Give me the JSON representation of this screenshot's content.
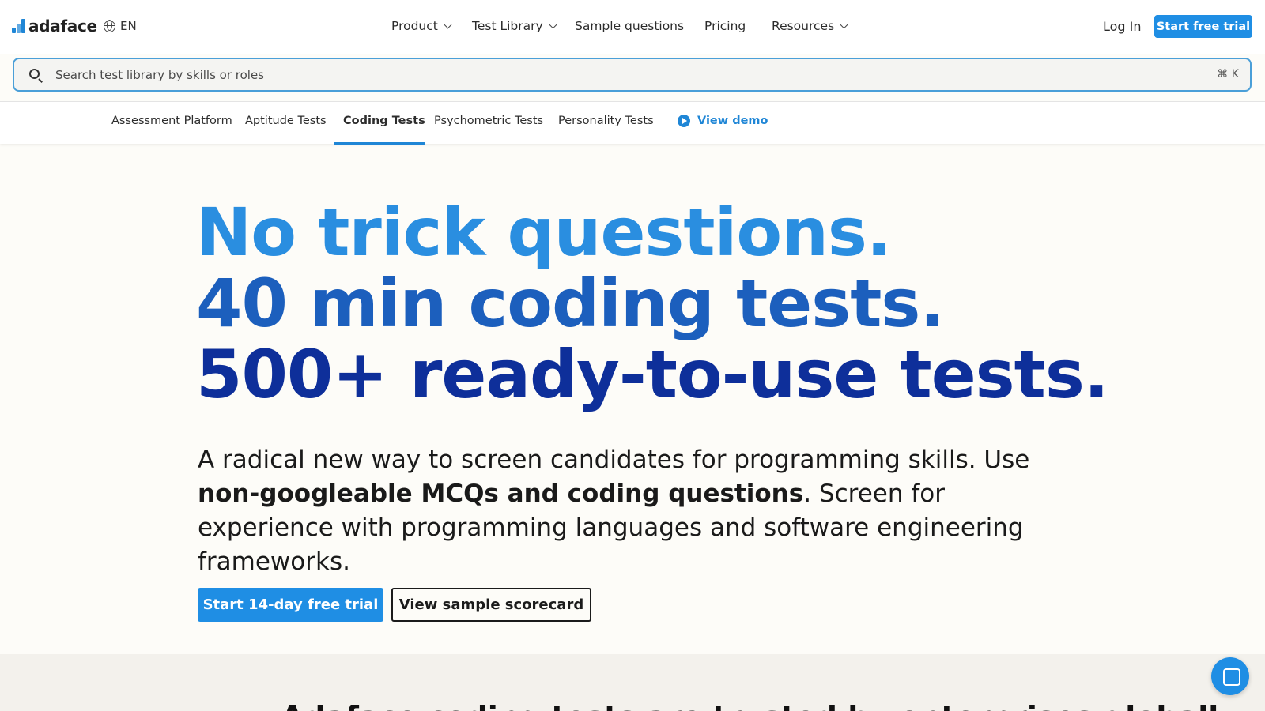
{
  "colors": {
    "accent": "#1f8ee4",
    "hero_line1": "#2a8ee0",
    "hero_line2": "#1c5fbd",
    "hero_line3": "#0e2f9a"
  },
  "header": {
    "brand": "adaface",
    "language": "EN",
    "menu": [
      {
        "label": "Product",
        "dropdown": true
      },
      {
        "label": "Test Library",
        "dropdown": true
      },
      {
        "label": "Sample questions",
        "dropdown": false
      },
      {
        "label": "Pricing",
        "dropdown": false
      },
      {
        "label": "Resources",
        "dropdown": true
      }
    ],
    "login": "Log In",
    "cta": "Start free trial"
  },
  "search": {
    "placeholder": "Search test library by skills or roles",
    "shortcut": "⌘ K"
  },
  "subnav": {
    "items": [
      "Assessment Platform",
      "Aptitude Tests",
      "Coding Tests",
      "Psychometric Tests",
      "Personality Tests"
    ],
    "active": "Coding Tests",
    "demo": "View demo"
  },
  "hero": {
    "line1": "No trick questions.",
    "line2": "40 min coding tests.",
    "line3": "500+ ready-to-use tests.",
    "desc_pre": "A radical new way to screen candidates for programming skills. Use ",
    "desc_bold": "non-googleable MCQs and coding questions",
    "desc_post": ". Screen for experience with programming languages and software engineering frameworks.",
    "cta_primary": "Start 14-day free trial",
    "cta_secondary": "View sample scorecard"
  },
  "band": {
    "title": "Adaface coding tests are trusted by enterprises globally"
  },
  "icons": [
    "logo-icon",
    "globe-icon",
    "chevron-down-icon",
    "search-icon",
    "play-icon",
    "chat-icon"
  ]
}
